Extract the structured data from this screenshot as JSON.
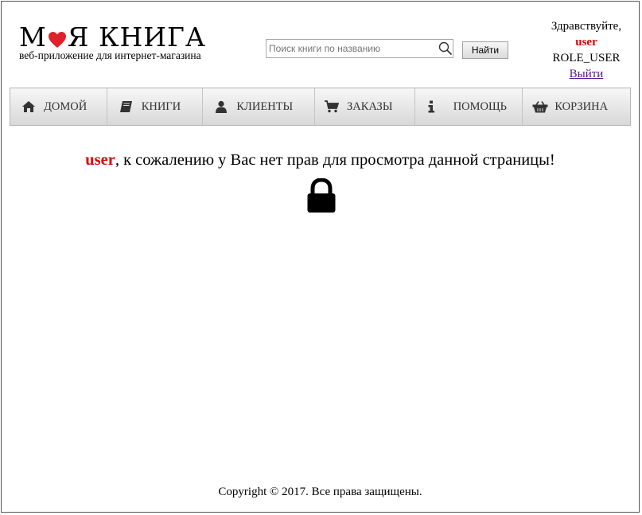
{
  "header": {
    "logo_word1": "М",
    "logo_word1_rest": "Я КНИГА",
    "logo_tagline": "веб-приложение для интернет-магазина",
    "search_placeholder": "Поиск книги по названию",
    "search_button": "Найти",
    "greeting": "Здравствуйте,",
    "username": "user",
    "role": "ROLE_USER",
    "logout": "Выйти"
  },
  "nav": {
    "items": [
      {
        "label": "ДОМОЙ",
        "icon": "home-icon"
      },
      {
        "label": "КНИГИ",
        "icon": "book-icon"
      },
      {
        "label": "КЛИЕНТЫ",
        "icon": "user-icon"
      },
      {
        "label": "ЗАКАЗЫ",
        "icon": "cart-icon"
      },
      {
        "label": "ПОМОЩЬ",
        "icon": "info-icon"
      },
      {
        "label": "КОРЗИНА",
        "icon": "basket-icon"
      }
    ]
  },
  "content": {
    "username": "user",
    "message": ", к сожалению у Вас нет прав для просмотра данной страницы!",
    "icon": "lock-icon"
  },
  "footer": {
    "text": "Copyright © 2017. Все права защищены."
  },
  "colors": {
    "accent_red": "#e00000",
    "nav_gradient_top": "#f7f7f7",
    "nav_gradient_bottom": "#d8d8d8"
  }
}
